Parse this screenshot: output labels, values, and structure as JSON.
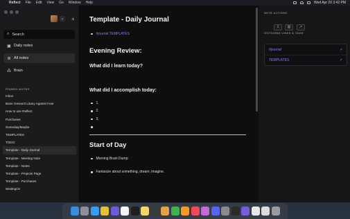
{
  "menubar": {
    "app": "Reflect",
    "items": [
      "File",
      "Edit",
      "View",
      "Go",
      "Window",
      "Help"
    ],
    "clock": "Wed Apr 20  3:42 PM"
  },
  "sidebar": {
    "search": "Search",
    "nav": [
      {
        "label": "Daily notes",
        "icon": "calendar-icon"
      },
      {
        "label": "All notes",
        "icon": "notes-icon"
      },
      {
        "label": "Brain",
        "icon": "brain-icon"
      }
    ],
    "pinned_label": "PINNED NOTES",
    "pinned": [
      "Inbox",
      "Bene Gesserit Litany Against Fear",
      "How to use Reflect",
      "Purchases",
      "Someday/Maybe",
      "TEMPLATES",
      "TODO",
      "Template - Daily Journal",
      "Template - Meeting Note",
      "Template - Notes",
      "Template - Projects Page",
      "Template - Purchases",
      "WaitingOn"
    ]
  },
  "note": {
    "title": "Template - Daily Journal",
    "tag": "#journal TEMPLATES",
    "evening_heading": "Evening Review:",
    "learn_heading": "What did I learn today?",
    "accomplish_heading": "What did I accomplish today:",
    "accomplish_list": [
      "1.",
      "2.",
      "3.",
      ""
    ],
    "start_heading": "Start of Day",
    "brain_dump": "Morning Brain Dump:",
    "fantasize_pre": "Fantasize about something, ",
    "fantasize_em": "dream",
    "fantasize_post": ", imagine."
  },
  "right_panel": {
    "actions_label": "NOTE ACTIONS",
    "actions": [
      "pin-icon",
      "trash-icon",
      "share-icon"
    ],
    "links_label": "OUTGOING LINKS & TAGS",
    "links": [
      {
        "label": "#journal"
      },
      {
        "label": "TEMPLATES"
      }
    ]
  },
  "dock": {
    "apps": [
      {
        "name": "finder-icon",
        "color": "#3b8de0"
      },
      {
        "name": "launchpad-icon",
        "color": "#8f8f99"
      },
      {
        "name": "safari-icon",
        "color": "#3d9bf0"
      },
      {
        "name": "chrome-icon",
        "color": "#e5c13a"
      },
      {
        "name": "orbit-icon",
        "color": "#6b5bd6"
      },
      {
        "name": "calendar-icon",
        "color": "#f4f4f4"
      },
      {
        "name": "reflect-icon",
        "color": "#1e1e1e"
      },
      {
        "name": "notes-icon",
        "color": "#f5d66a"
      },
      {
        "name": "tool-icon",
        "color": "#3a3a3a"
      },
      {
        "name": "photos-icon",
        "color": "#e0a34a"
      },
      {
        "name": "numbers-icon",
        "color": "#3fb14f"
      },
      {
        "name": "keynote-icon",
        "color": "#f09a2c"
      },
      {
        "name": "music-icon",
        "color": "#f04a5a"
      },
      {
        "name": "podcasts-icon",
        "color": "#c56bd8"
      },
      {
        "name": "discord-icon",
        "color": "#5865f2"
      },
      {
        "name": "settings-icon",
        "color": "#8a8a90"
      },
      {
        "name": "activity-icon",
        "color": "#2a2a2a"
      },
      {
        "name": "appstore-icon",
        "color": "#7a5bd8"
      },
      {
        "name": "document-icon",
        "color": "#e8e8e8"
      },
      {
        "name": "document2-icon",
        "color": "#dcdcdc"
      },
      {
        "name": "trash-icon",
        "color": "#9a9aa0"
      }
    ]
  }
}
